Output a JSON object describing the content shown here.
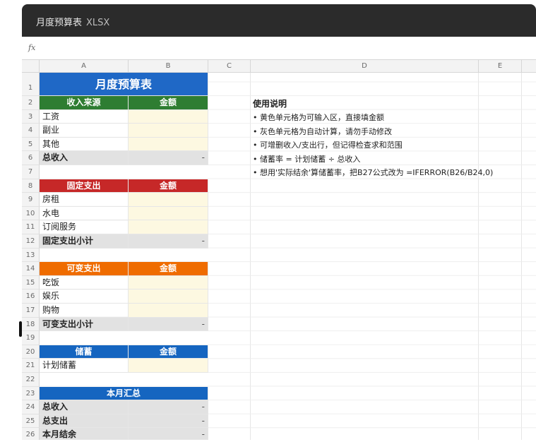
{
  "window": {
    "title": "月度预算表",
    "ext": "XLSX"
  },
  "formula_bar": {
    "fx_label": "fx"
  },
  "columns": [
    "A",
    "B",
    "C",
    "D",
    "E"
  ],
  "rows": [
    "1",
    "2",
    "3",
    "4",
    "5",
    "6",
    "7",
    "8",
    "9",
    "10",
    "11",
    "12",
    "13",
    "14",
    "15",
    "16",
    "17",
    "18",
    "19",
    "20",
    "21",
    "22",
    "23",
    "24",
    "25",
    "26"
  ],
  "sheet": {
    "title": "月度预算表",
    "income": {
      "header": "收入来源",
      "amount": "金额",
      "items": [
        "工资",
        "副业",
        "其他"
      ],
      "total_label": "总收入",
      "total_value": "-"
    },
    "fixed": {
      "header": "固定支出",
      "amount": "金额",
      "items": [
        "房租",
        "水电",
        "订阅服务"
      ],
      "total_label": "固定支出小计",
      "total_value": "-"
    },
    "variable": {
      "header": "可变支出",
      "amount": "金额",
      "items": [
        "吃饭",
        "娱乐",
        "购物"
      ],
      "total_label": "可变支出小计",
      "total_value": "-"
    },
    "savings": {
      "header": "储蓄",
      "amount": "金额",
      "items": [
        "计划储蓄"
      ]
    },
    "summary": {
      "header": "本月汇总",
      "items": [
        {
          "label": "总收入",
          "value": "-"
        },
        {
          "label": "总支出",
          "value": "-"
        },
        {
          "label": "本月结余",
          "value": "-"
        }
      ]
    }
  },
  "notes": {
    "title": "使用说明",
    "lines": [
      "• 黄色单元格为可输入区，直接填金额",
      "• 灰色单元格为自动计算，请勿手动修改",
      "• 可增删收入/支出行，但记得检查求和范围",
      "• 储蓄率 = 计划储蓄 ÷ 总收入",
      "• 想用'实际结余'算储蓄率，把B27公式改为 =IFERROR(B26/B24,0)"
    ]
  },
  "colors": {
    "title_blue": "#1f68c6",
    "income_green": "#2e7d32",
    "fixed_red": "#c62828",
    "variable_orange": "#ef6c00",
    "savings_blue": "#1565c0",
    "input_yellow": "#fdf8e1",
    "calc_gray": "#e2e2e2"
  }
}
